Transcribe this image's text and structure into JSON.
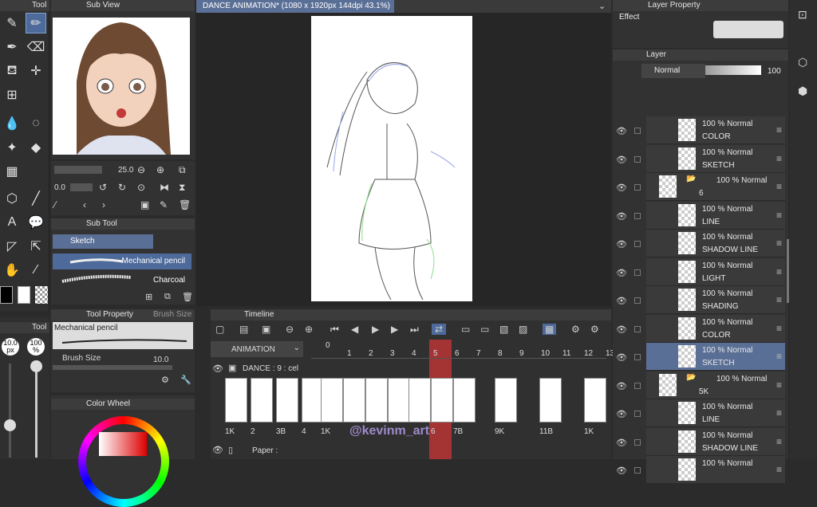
{
  "tool_panel": {
    "title": "Tool"
  },
  "sub_view": {
    "title": "Sub View"
  },
  "doc_tab": {
    "title": "DANCE ANIMATION* (1080 x 1920px 144dpi 43.1%)"
  },
  "layer_property": {
    "title": "Layer Property",
    "effect_label": "Effect"
  },
  "layer_panel": {
    "title": "Layer",
    "blend_mode": "Normal",
    "opacity": "100"
  },
  "nav": {
    "zoom": "25.0",
    "rotate": "0.0"
  },
  "sub_tool": {
    "title": "Sub Tool",
    "group": "Sketch",
    "items": [
      {
        "label": "Mechanical pencil"
      },
      {
        "label": "Charcoal"
      }
    ]
  },
  "tool_property": {
    "title": "Tool Property",
    "brush_size_tab": "Brush Size",
    "tool_name": "Mechanical pencil",
    "brush_size_label": "Brush Size",
    "brush_size_value": "10.0"
  },
  "brush_slider": {
    "size": "10.0",
    "size_unit": "px",
    "opacity": "100",
    "opacity_unit": "%",
    "title": "Tool"
  },
  "color_wheel": {
    "title": "Color Wheel"
  },
  "timeline": {
    "title": "Timeline",
    "track_name": "ANIMATION",
    "folder_track": "DANCE : 9 : cel",
    "paper_track": "Paper :",
    "frame_numbers": [
      "0",
      "1",
      "2",
      "3",
      "4",
      "5",
      "6",
      "7",
      "8",
      "9",
      "10",
      "11",
      "12",
      "13"
    ],
    "current_frame": "6",
    "cel_labels_left": [
      "1K",
      "2",
      "3B",
      "4"
    ],
    "cel_labels_right": [
      "1K",
      "6",
      "7B",
      "9K",
      "11B",
      "1K"
    ],
    "watermark": "@kevinm_art"
  },
  "layers": [
    {
      "mode": "100 % Normal",
      "name": "COLOR"
    },
    {
      "mode": "100 % Normal",
      "name": "SKETCH"
    },
    {
      "mode": "100 % Normal",
      "name": "6",
      "folder": true
    },
    {
      "mode": "100 % Normal",
      "name": "LINE"
    },
    {
      "mode": "100 % Normal",
      "name": "SHADOW LINE"
    },
    {
      "mode": "100 % Normal",
      "name": "LIGHT"
    },
    {
      "mode": "100 % Normal",
      "name": "SHADING"
    },
    {
      "mode": "100 % Normal",
      "name": "COLOR"
    },
    {
      "mode": "100 % Normal",
      "name": "SKETCH"
    },
    {
      "mode": "100 % Normal",
      "name": "5K",
      "folder": true
    },
    {
      "mode": "100 % Normal",
      "name": "LINE"
    },
    {
      "mode": "100 % Normal",
      "name": "SHADOW LINE"
    },
    {
      "mode": "100 % Normal",
      "name": ""
    }
  ],
  "colors": {
    "accent": "#4d6a9a",
    "timeline_red": "#b83434",
    "selected_layer": "#5a6f96"
  }
}
